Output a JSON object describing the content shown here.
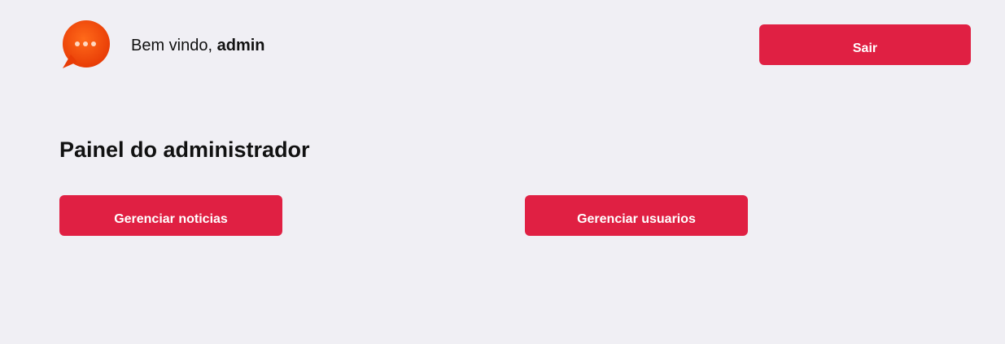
{
  "header": {
    "logo_icon": "chat-bubble-icon",
    "greeting_prefix": "Bem vindo, ",
    "username": "admin",
    "logout_label": "Sair"
  },
  "main": {
    "title": "Painel do administrador",
    "actions": [
      {
        "label": "Gerenciar noticias"
      },
      {
        "label": "Gerenciar usuarios"
      }
    ]
  },
  "colors": {
    "background": "#f0eff4",
    "accent": "#e02043",
    "logo": "#f04a0c"
  }
}
